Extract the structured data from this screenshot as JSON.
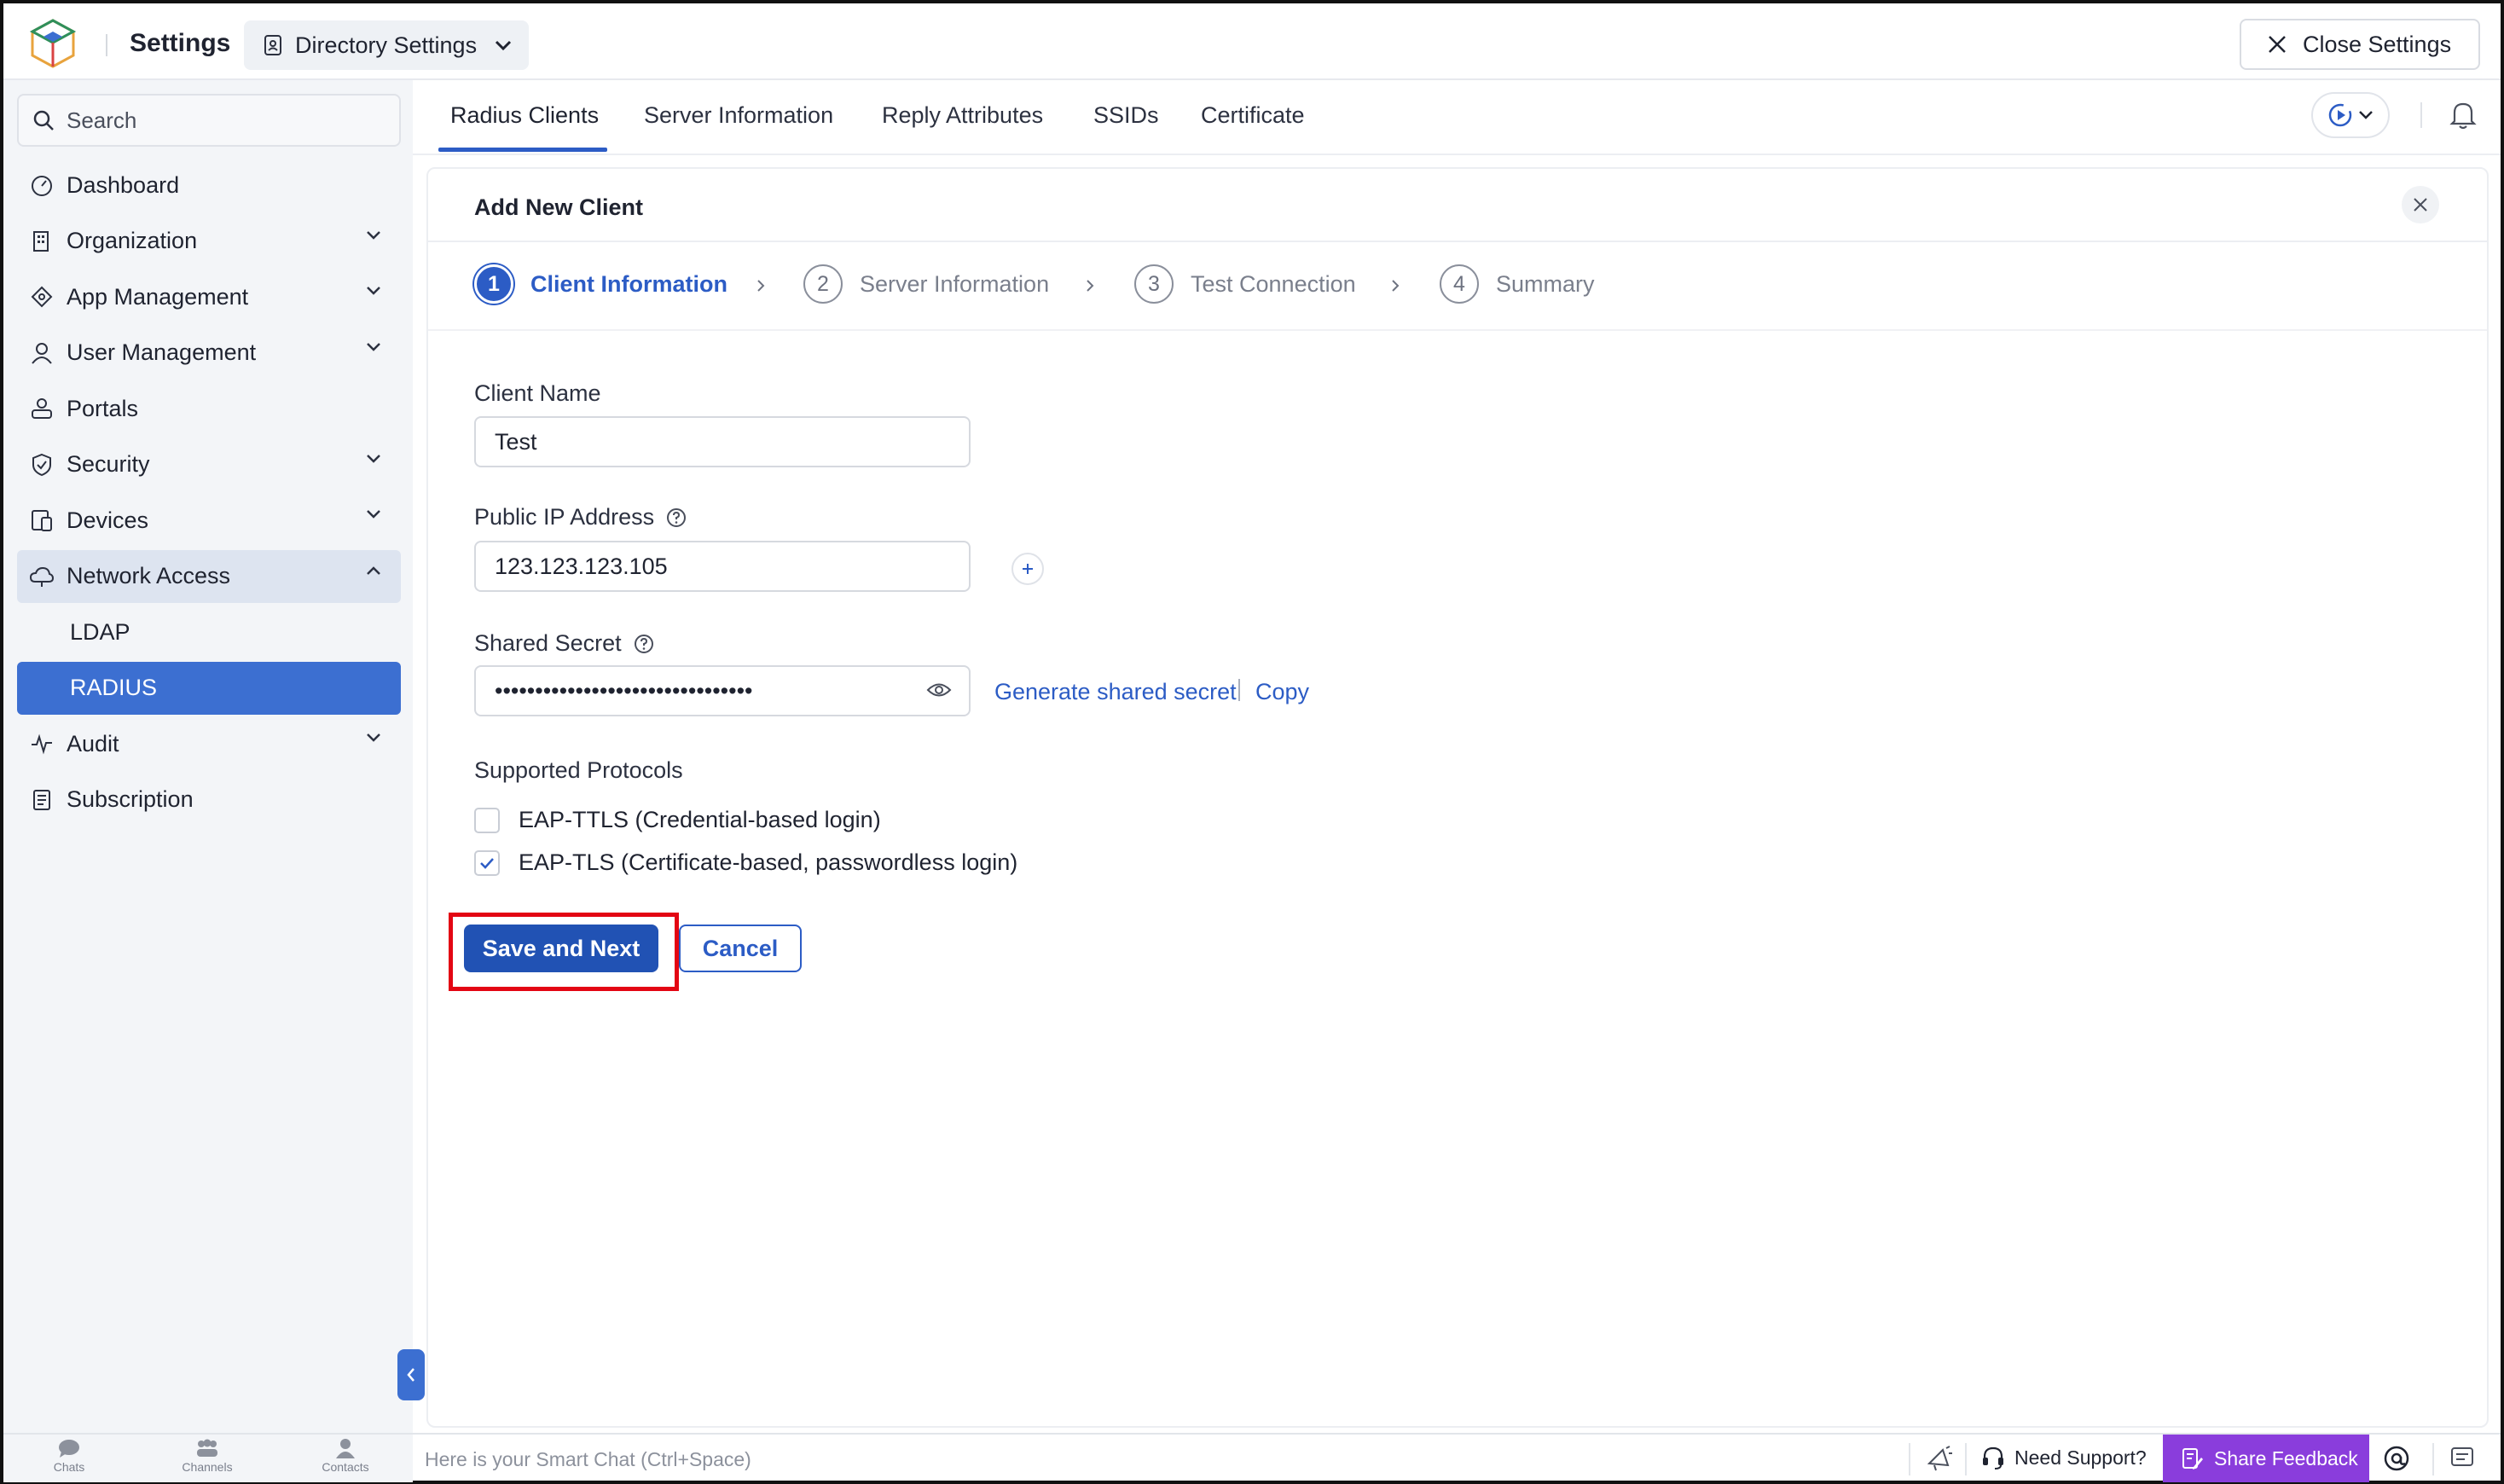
{
  "header": {
    "app_title": "Settings",
    "directory_button": "Directory Settings",
    "close_button": "Close Settings"
  },
  "sidebar": {
    "search_placeholder": "Search",
    "items": [
      {
        "label": "Dashboard",
        "icon": "dashboard-icon"
      },
      {
        "label": "Organization",
        "icon": "organization-icon"
      },
      {
        "label": "App Management",
        "icon": "app-management-icon"
      },
      {
        "label": "User Management",
        "icon": "user-icon"
      },
      {
        "label": "Portals",
        "icon": "portals-icon"
      },
      {
        "label": "Security",
        "icon": "shield-icon"
      },
      {
        "label": "Devices",
        "icon": "devices-icon"
      },
      {
        "label": "Network Access",
        "icon": "cloud-icon"
      },
      {
        "label": "LDAP"
      },
      {
        "label": "RADIUS"
      },
      {
        "label": "Audit",
        "icon": "pulse-icon"
      },
      {
        "label": "Subscription",
        "icon": "document-icon"
      }
    ]
  },
  "tabs": [
    "Radius Clients",
    "Server Information",
    "Reply Attributes",
    "SSIDs",
    "Certificate"
  ],
  "card": {
    "title": "Add New Client",
    "steps": [
      {
        "num": "1",
        "label": "Client Information"
      },
      {
        "num": "2",
        "label": "Server Information"
      },
      {
        "num": "3",
        "label": "Test Connection"
      },
      {
        "num": "4",
        "label": "Summary"
      }
    ],
    "form": {
      "client_name_label": "Client Name",
      "client_name_value": "Test",
      "public_ip_label": "Public IP Address",
      "public_ip_value": "123.123.123.105",
      "shared_secret_label": "Shared Secret",
      "shared_secret_value": "••••••••••••••••••••••••••••••••",
      "generate_link": "Generate shared secret",
      "copy_link": "Copy",
      "protocols_label": "Supported Protocols",
      "protocol_ttls": "EAP-TTLS (Credential-based login)",
      "protocol_tls": "EAP-TLS (Certificate-based, passwordless login)",
      "protocol_ttls_checked": false,
      "protocol_tls_checked": true
    },
    "buttons": {
      "save": "Save and Next",
      "cancel": "Cancel"
    }
  },
  "bottombar": {
    "chats": "Chats",
    "channels": "Channels",
    "contacts": "Contacts",
    "smartchat_placeholder": "Here is your Smart Chat (Ctrl+Space)",
    "need_support": "Need Support?",
    "share_feedback": "Share Feedback"
  },
  "colors": {
    "accent": "#2c5cc5",
    "sidebar_active": "#3c6fd1",
    "highlight": "#e30613",
    "feedback": "#8a3ddc"
  }
}
